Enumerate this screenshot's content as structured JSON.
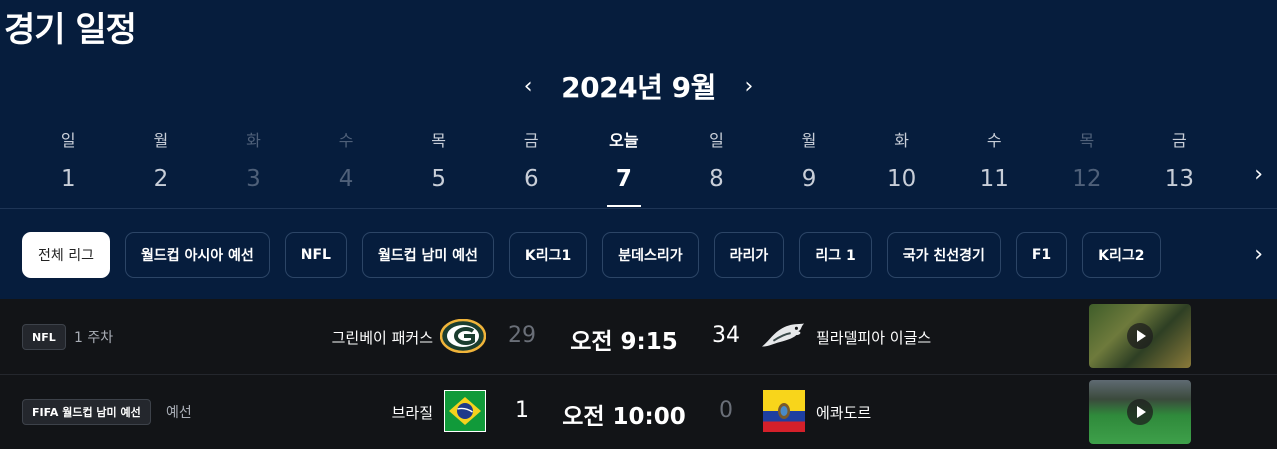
{
  "page_title": "경기 일정",
  "calendar": {
    "month_label": "2024년 9월",
    "days": [
      {
        "weekday": "일",
        "date": "1",
        "state": "normal"
      },
      {
        "weekday": "월",
        "date": "2",
        "state": "normal"
      },
      {
        "weekday": "화",
        "date": "3",
        "state": "dim"
      },
      {
        "weekday": "수",
        "date": "4",
        "state": "dim"
      },
      {
        "weekday": "목",
        "date": "5",
        "state": "normal"
      },
      {
        "weekday": "금",
        "date": "6",
        "state": "normal"
      },
      {
        "weekday": "오늘",
        "date": "7",
        "state": "active"
      },
      {
        "weekday": "일",
        "date": "8",
        "state": "normal"
      },
      {
        "weekday": "월",
        "date": "9",
        "state": "normal"
      },
      {
        "weekday": "화",
        "date": "10",
        "state": "normal"
      },
      {
        "weekday": "수",
        "date": "11",
        "state": "normal"
      },
      {
        "weekday": "목",
        "date": "12",
        "state": "dim"
      },
      {
        "weekday": "금",
        "date": "13",
        "state": "normal"
      }
    ]
  },
  "leagues": [
    {
      "label": "전체 리그",
      "active": true
    },
    {
      "label": "월드컵 아시아 예선",
      "active": false
    },
    {
      "label": "NFL",
      "active": false
    },
    {
      "label": "월드컵 남미 예선",
      "active": false
    },
    {
      "label": "K리그1",
      "active": false
    },
    {
      "label": "분데스리가",
      "active": false
    },
    {
      "label": "라리가",
      "active": false
    },
    {
      "label": "리그 1",
      "active": false
    },
    {
      "label": "국가 친선경기",
      "active": false
    },
    {
      "label": "F1",
      "active": false
    },
    {
      "label": "K리그2",
      "active": false
    }
  ],
  "games": [
    {
      "league_badge": "NFL",
      "round": "1 주차",
      "home_team": "그린베이 패커스",
      "home_score": "29",
      "time": "오전 9:15",
      "away_score": "34",
      "away_team": "필라델피아 이글스",
      "home_logo": "packers-logo-icon",
      "away_logo": "eagles-logo-icon"
    },
    {
      "league_badge": "FIFA 월드컵 남미 예선",
      "round": "예선",
      "home_team": "브라질",
      "home_score": "1",
      "time": "오전 10:00",
      "away_score": "0",
      "away_team": "에콰도르",
      "home_logo": "brazil-flag-icon",
      "away_logo": "ecuador-flag-icon"
    }
  ],
  "colors": {
    "background": "#061d3d",
    "games_background": "#121417",
    "dim_text": "#4f6079"
  }
}
